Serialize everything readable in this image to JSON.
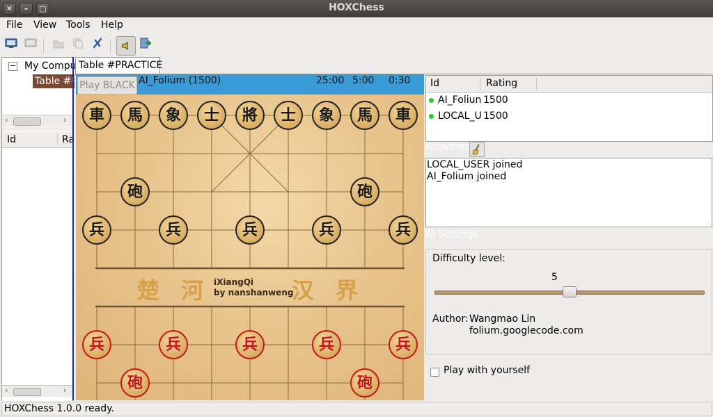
{
  "window": {
    "title": "HOXChess",
    "close": "✕",
    "minimize": "–",
    "maximize": "▢"
  },
  "menu": {
    "file": "File",
    "view": "View",
    "tools": "Tools",
    "help": "Help"
  },
  "toolbar": {
    "icons": [
      "connect-icon",
      "disconnect-icon",
      "open-table-icon",
      "copy-icon",
      "close-table-icon",
      "sound-icon",
      "exit-icon"
    ]
  },
  "sites_tree": {
    "root": "My Compu",
    "child": "Table #P",
    "collapse_glyph": "−"
  },
  "left_players": {
    "col_id": "Id",
    "col_rating": "Ra"
  },
  "table_tab": {
    "label": "Table #PRACTICE"
  },
  "infobar": {
    "play_button": "Play BLACK",
    "opponent": "AI_Folium (1500)",
    "game_time": "25:00",
    "move_time": "5:00",
    "free_time": "0:30"
  },
  "board": {
    "river_left": "楚 河",
    "river_right": "汉 界",
    "river_title": "iXiangQi",
    "river_subtitle": "by nanshanweng",
    "black_pieces": [
      {
        "glyph": "車",
        "name": "black-chariot-left"
      },
      {
        "glyph": "馬",
        "name": "black-horse-left"
      },
      {
        "glyph": "象",
        "name": "black-elephant-left"
      },
      {
        "glyph": "士",
        "name": "black-advisor-left"
      },
      {
        "glyph": "將",
        "name": "black-general"
      },
      {
        "glyph": "士",
        "name": "black-advisor-right"
      },
      {
        "glyph": "象",
        "name": "black-elephant-right"
      },
      {
        "glyph": "馬",
        "name": "black-horse-right"
      },
      {
        "glyph": "車",
        "name": "black-chariot-right"
      },
      {
        "glyph": "砲",
        "name": "black-cannon-left"
      },
      {
        "glyph": "砲",
        "name": "black-cannon-right"
      },
      {
        "glyph": "兵",
        "name": "black-soldier-1"
      },
      {
        "glyph": "兵",
        "name": "black-soldier-2"
      },
      {
        "glyph": "兵",
        "name": "black-soldier-3"
      },
      {
        "glyph": "兵",
        "name": "black-soldier-4"
      },
      {
        "glyph": "兵",
        "name": "black-soldier-5"
      }
    ],
    "red_pieces": [
      {
        "glyph": "兵",
        "name": "red-soldier-1"
      },
      {
        "glyph": "兵",
        "name": "red-soldier-2"
      },
      {
        "glyph": "兵",
        "name": "red-soldier-3"
      },
      {
        "glyph": "兵",
        "name": "red-soldier-4"
      },
      {
        "glyph": "兵",
        "name": "red-soldier-5"
      },
      {
        "glyph": "砲",
        "name": "red-cannon-left"
      },
      {
        "glyph": "砲",
        "name": "red-cannon-right"
      }
    ]
  },
  "players_list": {
    "col_id": "Id",
    "col_rating": "Rating",
    "rows": [
      {
        "id": "AI_Foliun",
        "rating": "1500"
      },
      {
        "id": "LOCAL_U",
        "rating": "1500"
      }
    ]
  },
  "activities": {
    "label": "Activities",
    "clear_icon": "broom-icon",
    "lines": [
      "LOCAL_USER joined",
      "AI_Folium joined"
    ]
  },
  "ai_settings": {
    "label": "AI Settings",
    "difficulty_label": "Difficulty level:",
    "difficulty_value": "5",
    "difficulty_fraction": 0.5,
    "author_label": "Author:",
    "author_name": "Wangmao Lin",
    "author_site": "folium.googlecode.com"
  },
  "play_with_yourself": {
    "label": "Play with yourself",
    "checked": false
  },
  "status": {
    "text": "HOXChess 1.0.0 ready."
  },
  "colors": {
    "accent": "#3a9ad5",
    "titlebar": "#3c3b37",
    "selection": "#7c4a34",
    "red_piece": "#c4161c"
  }
}
